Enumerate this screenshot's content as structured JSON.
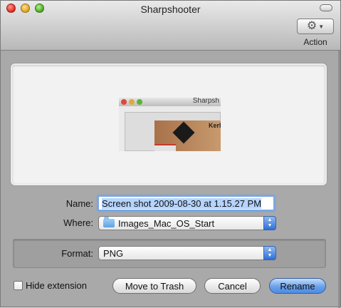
{
  "window": {
    "title": "Sharpshooter"
  },
  "toolbar": {
    "action_label": "Action"
  },
  "form": {
    "name_label": "Name:",
    "name_value": "Screen shot 2009-08-30 at 1.15.27 PM",
    "where_label": "Where:",
    "where_value": "Images_Mac_OS_Start",
    "format_label": "Format:",
    "format_value": "PNG"
  },
  "thumbnail": {
    "window_title": "Sharpsh",
    "brand_text": "Kerl"
  },
  "footer": {
    "hide_extension_label": "Hide extension",
    "hide_extension_checked": false,
    "trash_button": "Move to Trash",
    "cancel_button": "Cancel",
    "rename_button": "Rename"
  },
  "colors": {
    "default_button": "#4d8be3",
    "focus_ring": "#7aa7e2"
  },
  "icons": [
    "close-icon",
    "minimize-icon",
    "zoom-icon",
    "gear-icon",
    "folder-icon",
    "popup-arrows-icon"
  ]
}
